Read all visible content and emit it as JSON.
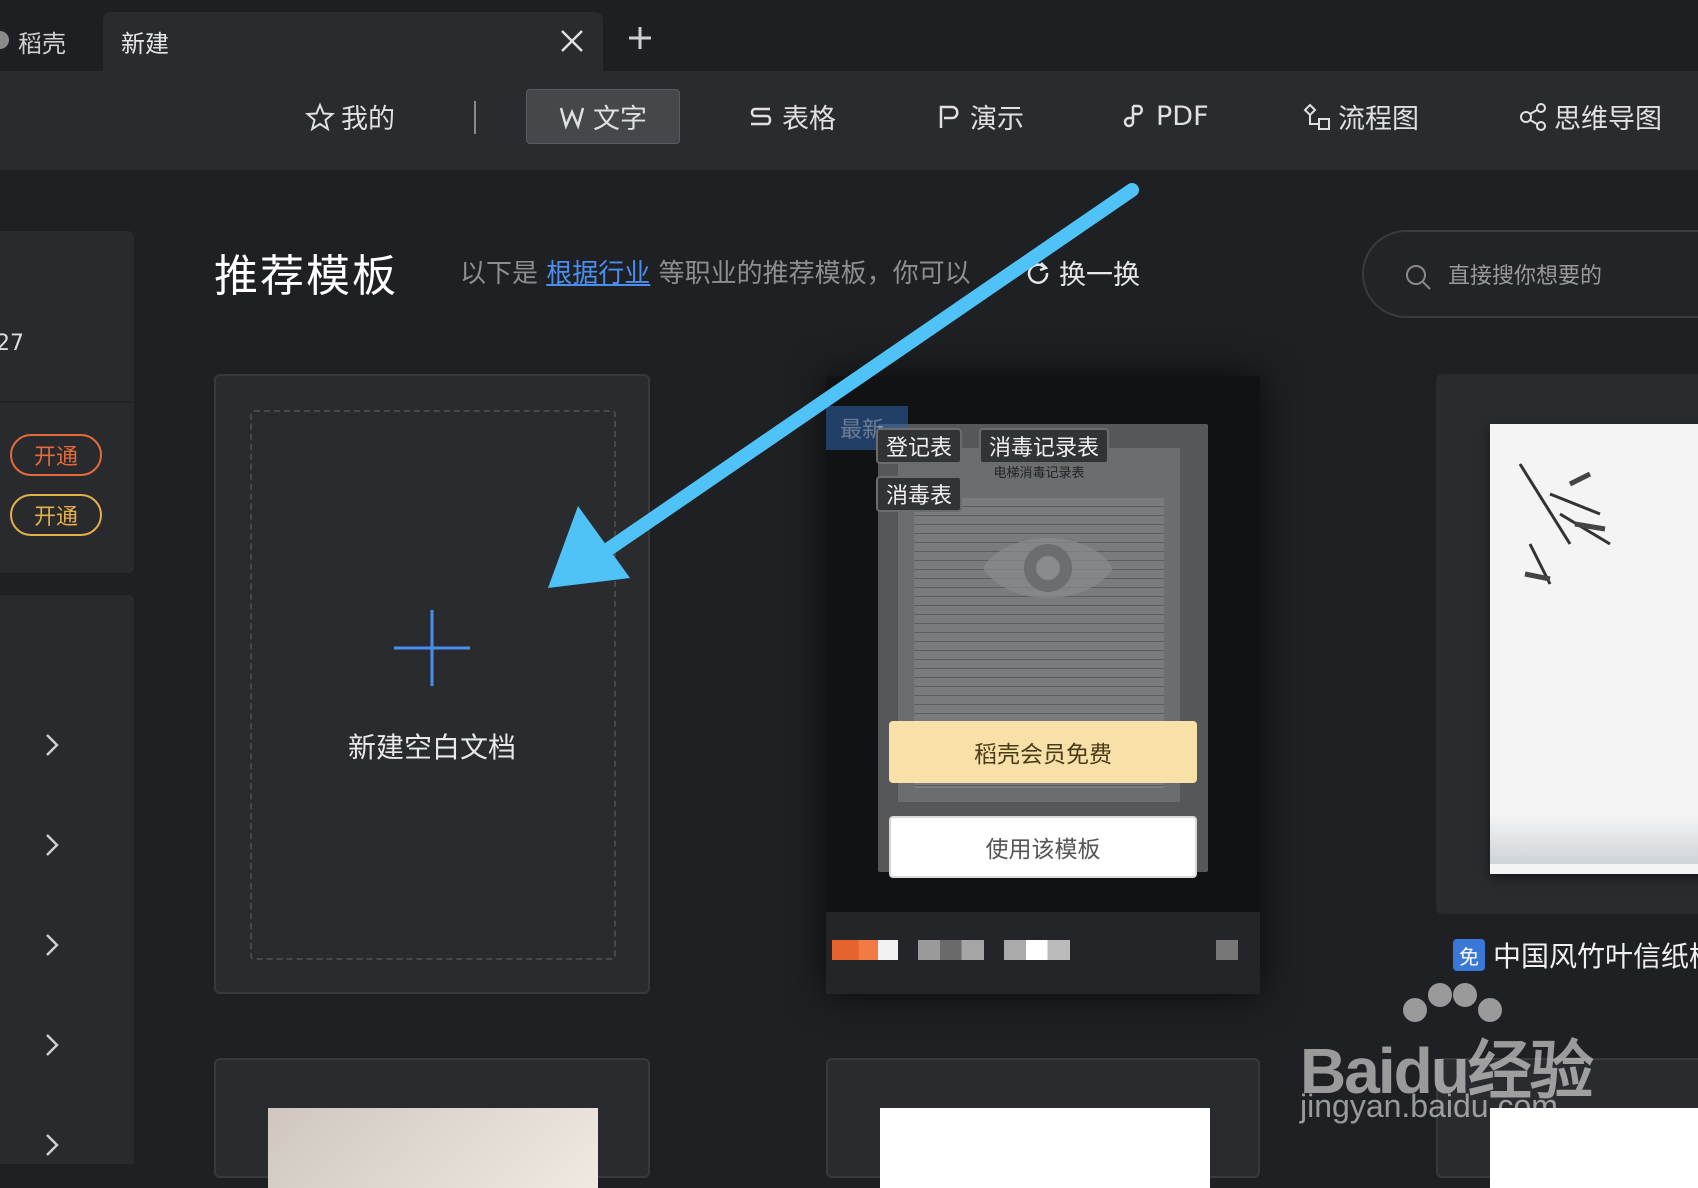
{
  "tabs": {
    "home_label": "稻壳",
    "new_label": "新建"
  },
  "categories": {
    "mine": "我的",
    "text": "文字",
    "sheet": "表格",
    "slides": "演示",
    "pdf": "PDF",
    "flow": "流程图",
    "mind": "思维导图"
  },
  "left": {
    "number_fragment": "27",
    "pill_1": "开通",
    "pill_2": "开通"
  },
  "section": {
    "title": "推荐模板",
    "subtitle_prefix": "以下是",
    "subtitle_link": "根据行业",
    "subtitle_suffix": "等职业的推荐模板，你可以",
    "refresh_label": "换一换"
  },
  "search": {
    "placeholder": "直接搜你想要的"
  },
  "blank_card": {
    "label": "新建空白文档"
  },
  "template_card": {
    "badge": "最新",
    "doc_title": "电梯消毒记录表",
    "tags": [
      "登记表",
      "消毒记录表",
      "消毒表"
    ],
    "vip_button": "稻壳会员免费",
    "use_button": "使用该模板"
  },
  "right_card": {
    "free_badge": "免",
    "title": "中国风竹叶信纸模"
  },
  "watermark": {
    "brand": "Baidu经验",
    "url": "jingyan.baidu.com"
  },
  "colors": {
    "accent_blue": "#4a8ef0",
    "vip_gold": "#f7e1a8",
    "pill_orange": "#e46a3a",
    "pill_yellow": "#e4b04a",
    "arrow_blue": "#4fc3f7"
  }
}
